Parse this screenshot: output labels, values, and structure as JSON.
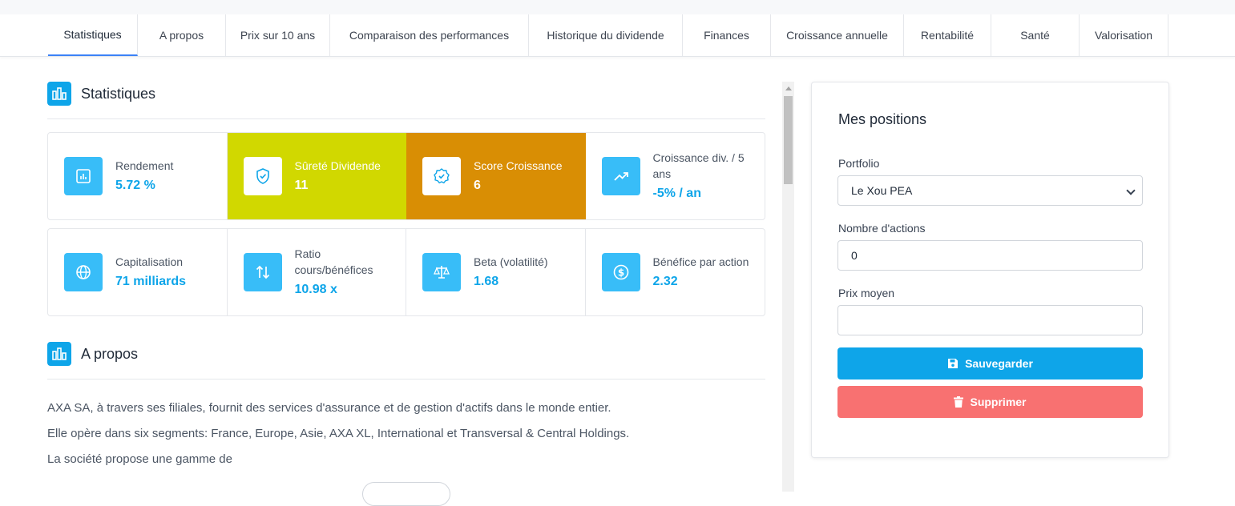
{
  "tabs": [
    {
      "label": "Statistiques",
      "active": true
    },
    {
      "label": "A propos"
    },
    {
      "label": "Prix sur 10 ans"
    },
    {
      "label": "Comparaison des performances"
    },
    {
      "label": "Historique du dividende"
    },
    {
      "label": "Finances"
    },
    {
      "label": "Croissance annuelle"
    },
    {
      "label": "Rentabilité"
    },
    {
      "label": "Santé"
    },
    {
      "label": "Valorisation"
    }
  ],
  "stats": {
    "title": "Statistiques",
    "row1": [
      {
        "label": "Rendement",
        "value": "5.72 %",
        "icon": "chart-icon"
      },
      {
        "label": "Sûreté Dividende",
        "value": "11",
        "icon": "shield-check-icon",
        "color": "#d1d800"
      },
      {
        "label": "Score Croissance",
        "value": "6",
        "icon": "badge-check-icon",
        "color": "#d98e04"
      },
      {
        "label": "Croissance div. / 5 ans",
        "value": "-5% / an",
        "icon": "trending-up-icon"
      }
    ],
    "row2": [
      {
        "label": "Capitalisation",
        "value": "71 milliards",
        "icon": "globe-icon"
      },
      {
        "label": "Ratio cours/bénéfices",
        "value": "10.98 x",
        "icon": "arrows-updown-icon"
      },
      {
        "label": "Beta (volatilité)",
        "value": "1.68",
        "icon": "scale-icon"
      },
      {
        "label": "Bénéfice par action",
        "value": "2.32",
        "icon": "dollar-icon"
      }
    ]
  },
  "about": {
    "title": "A propos",
    "lines": [
      "AXA SA, à travers ses filiales, fournit des services d'assurance et de gestion d'actifs dans le monde entier.",
      "Elle opère dans six segments: France, Europe, Asie, AXA XL, International et Transversal & Central Holdings.",
      "La société propose une gamme de"
    ]
  },
  "positions": {
    "title": "Mes positions",
    "portfolio_label": "Portfolio",
    "portfolio_value": "Le Xou PEA",
    "shares_label": "Nombre d'actions",
    "shares_value": "0",
    "price_label": "Prix moyen",
    "price_value": "",
    "save_label": "Sauvegarder",
    "delete_label": "Supprimer"
  },
  "colors": {
    "accent": "#0ea5e9",
    "icon_bg": "#38bdf8",
    "danger": "#f87171",
    "tab_active": "#3b82f6"
  }
}
